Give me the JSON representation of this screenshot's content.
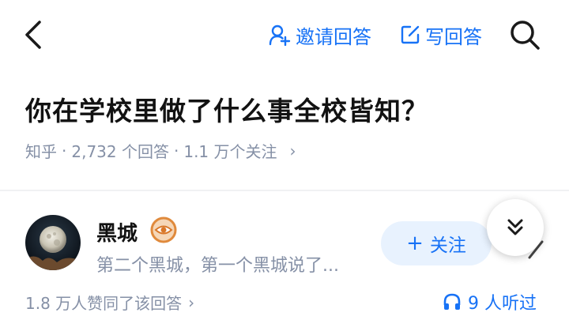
{
  "header": {
    "invite_label": "邀请回答",
    "write_label": "写回答"
  },
  "question": {
    "title": "你在学校里做了什么事全校皆知？",
    "source": "知乎",
    "separator": "·",
    "answer_count": "2,732 个回答",
    "follow_count": "1.1 万个关注",
    "chevron": "›"
  },
  "answer": {
    "author_name": "黑城",
    "author_bio": "第二个黑城，第一个黑城说了...",
    "follow_label": "关注",
    "follow_plus": "+",
    "likes_text": "1.8 万人赞同了该回答",
    "likes_chevron": "›",
    "listeners_text": "9 人听过"
  },
  "colors": {
    "accent": "#1772f6",
    "meta_gray": "#8590a6",
    "follow_bg": "#e8f2fe"
  },
  "icons": [
    "back-arrow-icon",
    "add-user-icon",
    "edit-icon",
    "search-icon",
    "badge-eye-icon",
    "double-chevron-down-icon",
    "pen-icon",
    "headphones-icon"
  ]
}
